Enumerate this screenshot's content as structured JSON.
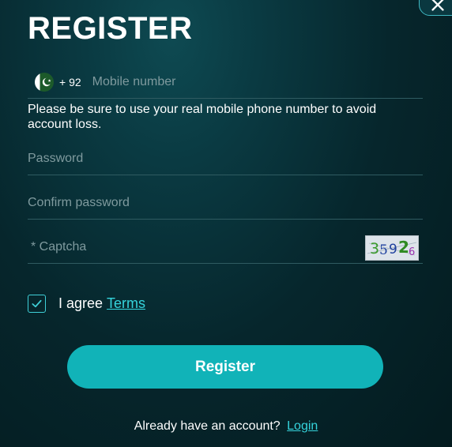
{
  "title": "REGISTER",
  "icons": {
    "close": "close-icon",
    "flag": "pakistan-flag-icon",
    "check": "checkmark-icon",
    "captcha": "captcha-image"
  },
  "phone": {
    "country_code": "+ 92",
    "placeholder": "Mobile number",
    "value": ""
  },
  "hint": "Please be sure to use your real mobile phone number to avoid account loss.",
  "password": {
    "placeholder": "Password",
    "value": ""
  },
  "confirm_password": {
    "placeholder": "Confirm password",
    "value": ""
  },
  "captcha": {
    "placeholder": "* Captcha",
    "value": "",
    "code": [
      "3",
      "5",
      "9",
      "2",
      "6"
    ],
    "code_colors": [
      "#3a9a2a",
      "#1d3f9e",
      "#1d3f9e",
      "#2f8a22",
      "#9a2fae"
    ]
  },
  "agree": {
    "checked": true,
    "text": "I agree",
    "terms_label": "Terms"
  },
  "register_button": "Register",
  "login_prompt": {
    "text": "Already have an account?",
    "link": "Login"
  },
  "colors": {
    "accent": "#11b3b8",
    "link": "#35d4dc",
    "background": "#06262c"
  }
}
